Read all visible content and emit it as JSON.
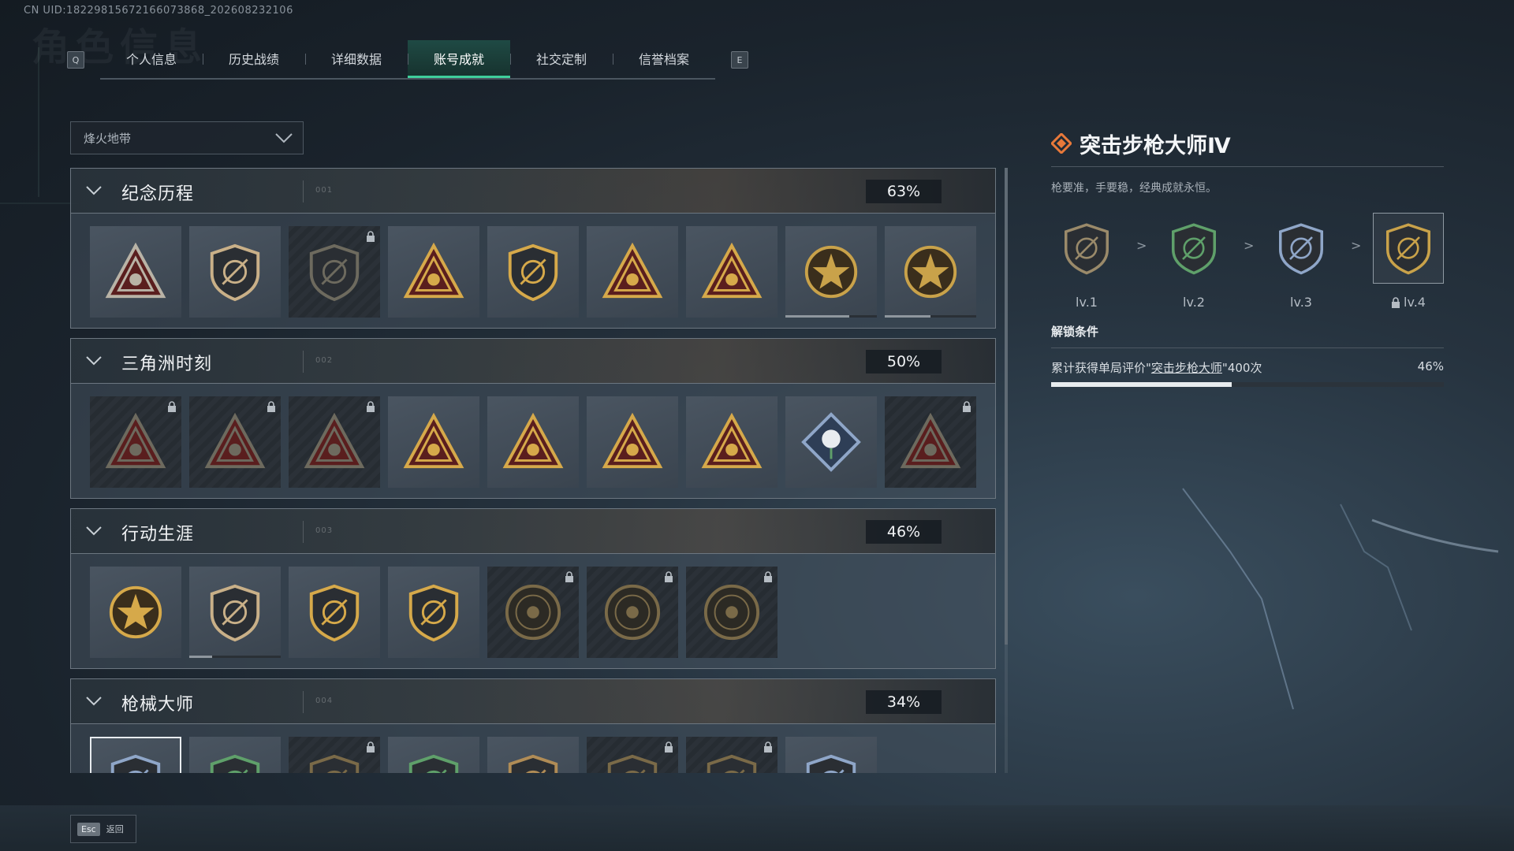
{
  "uid_text": "CN UID:1822981567216607386​8_202608232106",
  "ghost_title": "角色信息",
  "tabs": {
    "key_left": "Q",
    "key_right": "E",
    "items": [
      "个人信息",
      "历史战绩",
      "详细数据",
      "账号成就",
      "社交定制",
      "信誉档案"
    ],
    "active_index": 3
  },
  "filter": {
    "selected": "烽火地带"
  },
  "sections": [
    {
      "name": "纪念历程",
      "code": "001",
      "percent": "63%",
      "tiles": [
        {
          "icon": "delta-badge-icon",
          "locked": false,
          "progress": null,
          "color": "#b9b3a6"
        },
        {
          "icon": "helicopter-badge-icon",
          "locked": false,
          "progress": null,
          "color": "#c9b088"
        },
        {
          "icon": "shield-emblem-icon",
          "locked": true,
          "progress": null,
          "color": "#6d6a5e"
        },
        {
          "icon": "tower-triangle-icon",
          "locked": false,
          "progress": null,
          "color": "#d6a94a"
        },
        {
          "icon": "trophy-500-icon",
          "locked": false,
          "progress": null,
          "color": "#d6a94a"
        },
        {
          "icon": "boat-triangle-icon",
          "locked": false,
          "progress": null,
          "color": "#d6a94a"
        },
        {
          "icon": "number-one-triangle-icon",
          "locked": false,
          "progress": null,
          "color": "#d6a94a"
        },
        {
          "icon": "delta-force-round-icon",
          "locked": false,
          "progress": 0.7,
          "color": "#c9a24a"
        },
        {
          "icon": "delta-force-2026-icon",
          "locked": false,
          "progress": 0.5,
          "color": "#c9a24a"
        }
      ]
    },
    {
      "name": "三角洲时刻",
      "code": "002",
      "percent": "50%",
      "tiles": [
        {
          "icon": "bottle-triangle-icon",
          "locked": true,
          "progress": null,
          "color": "#6d6a5e"
        },
        {
          "icon": "figure-triangle-icon",
          "locked": true,
          "progress": null,
          "color": "#6d6a5e"
        },
        {
          "icon": "gear-triangle-icon",
          "locked": true,
          "progress": null,
          "color": "#6d6a5e"
        },
        {
          "icon": "squad-triangle-icon",
          "locked": false,
          "progress": null,
          "color": "#d6a94a"
        },
        {
          "icon": "battle-triangle-icon",
          "locked": false,
          "progress": null,
          "color": "#d6a94a"
        },
        {
          "icon": "rocket-triangle-icon",
          "locked": false,
          "progress": null,
          "color": "#d6a94a"
        },
        {
          "icon": "fish-triangle-icon",
          "locked": false,
          "progress": null,
          "color": "#d6a94a"
        },
        {
          "icon": "rose-diamond-icon",
          "locked": false,
          "progress": null,
          "color": "#8fa6c8"
        },
        {
          "icon": "skull-triangle-icon",
          "locked": true,
          "progress": null,
          "color": "#6d6a5e"
        }
      ]
    },
    {
      "name": "行动生涯",
      "code": "003",
      "percent": "46%",
      "tiles": [
        {
          "icon": "star-medal-icon",
          "locked": false,
          "progress": null,
          "color": "#d6a94a"
        },
        {
          "icon": "shield-chevron-icon",
          "locked": false,
          "progress": 0.25,
          "color": "#c9b088"
        },
        {
          "icon": "winged-shield-icon",
          "locked": false,
          "progress": null,
          "color": "#d6a94a"
        },
        {
          "icon": "diamond-shield-icon",
          "locked": false,
          "progress": null,
          "color": "#d6a94a"
        },
        {
          "icon": "helmet-coin-icon",
          "locked": true,
          "progress": null,
          "color": "#7a6a48"
        },
        {
          "icon": "sniper-coin-icon",
          "locked": true,
          "progress": null,
          "color": "#7a6a48"
        },
        {
          "icon": "eye-coin-icon",
          "locked": true,
          "progress": null,
          "color": "#7a6a48"
        }
      ]
    },
    {
      "name": "枪械大师",
      "code": "004",
      "percent": "34%",
      "tiles": [
        {
          "icon": "rifle-shield-blue-icon",
          "locked": false,
          "progress": null,
          "color": "#8fa6c8",
          "selected": true
        },
        {
          "icon": "rifle-shield-green-icon",
          "locked": false,
          "progress": null,
          "color": "#5fa06a"
        },
        {
          "icon": "rifle-shield-bronze-icon",
          "locked": true,
          "progress": null,
          "color": "#7a6a48"
        },
        {
          "icon": "rifle-shield-green-icon",
          "locked": false,
          "progress": null,
          "color": "#5fa06a"
        },
        {
          "icon": "rifle-shield-bronze-icon",
          "locked": false,
          "progress": null,
          "color": "#b08c56"
        },
        {
          "icon": "rifle-shield-bronze-icon",
          "locked": true,
          "progress": null,
          "color": "#7a6a48"
        },
        {
          "icon": "rifle-shield-bronze-icon",
          "locked": true,
          "progress": null,
          "color": "#7a6a48"
        },
        {
          "icon": "rifle-shield-blue-icon",
          "locked": false,
          "progress": null,
          "color": "#8fa6c8"
        }
      ]
    }
  ],
  "detail": {
    "title": "突击步枪大师Ⅳ",
    "description": "枪要准，手要稳，经典成就永恒。",
    "levels": [
      {
        "label": "lv.1",
        "color": "#9a8a6a",
        "locked": false
      },
      {
        "label": "lv.2",
        "color": "#5fa06a",
        "locked": false
      },
      {
        "label": "lv.3",
        "color": "#8fa6c8",
        "locked": false
      },
      {
        "label": "lv.4",
        "color": "#c9a24a",
        "locked": true
      }
    ],
    "arrow": ">",
    "unlock_heading": "解锁条件",
    "condition_prefix": "累计获得单局评价\"",
    "condition_link": "突击步枪大师",
    "condition_suffix": "\"400次",
    "condition_percent": "46%",
    "condition_progress": 0.46
  },
  "footer": {
    "esc_key": "Esc",
    "esc_label": "返回"
  },
  "colors": {
    "accent": "#3fcf9c",
    "title_icon": "#e8793a"
  }
}
